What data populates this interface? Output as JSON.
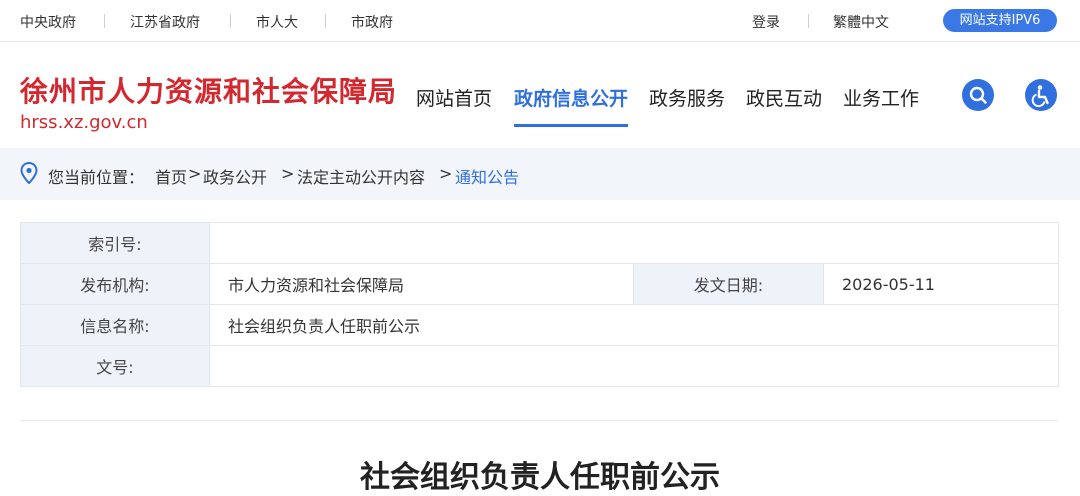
{
  "topbar": {
    "links": [
      "中央政府",
      "江苏省政府",
      "市人大",
      "市政府"
    ],
    "login": "登录",
    "traditional": "繁體中文",
    "ipv6_badge": "网站支持IPV6"
  },
  "header": {
    "site_name": "徐州市人力资源和社会保障局",
    "domain": "hrss.xz.gov.cn",
    "nav": [
      "网站首页",
      "政府信息公开",
      "政务服务",
      "政民互动",
      "业务工作"
    ],
    "active_nav": "政府信息公开",
    "icons": [
      "search-icon",
      "accessibility-icon"
    ]
  },
  "breadcrumb": {
    "prefix": "您当前位置：",
    "items": [
      "首页",
      ">",
      "政务公开",
      ">",
      "法定主动公开内容",
      ">",
      "通知公告"
    ]
  },
  "info_table": {
    "index_label": "索引号:",
    "index_value": "",
    "org_label": "发布机构:",
    "org_value": "市人力资源和社会保障局",
    "date_label": "发文日期:",
    "date_value": "2026-05-11",
    "name_label": "信息名称:",
    "name_value": "社会组织负责人任职前公示",
    "docno_label": "文号:",
    "docno_value": ""
  },
  "article": {
    "title": "社会组织负责人任职前公示"
  },
  "colors": {
    "brand_red": "#d2282f",
    "accent_blue": "#2f6fde",
    "label_bg": "#eef3fa",
    "crumb_bg": "#f2f6fb"
  }
}
